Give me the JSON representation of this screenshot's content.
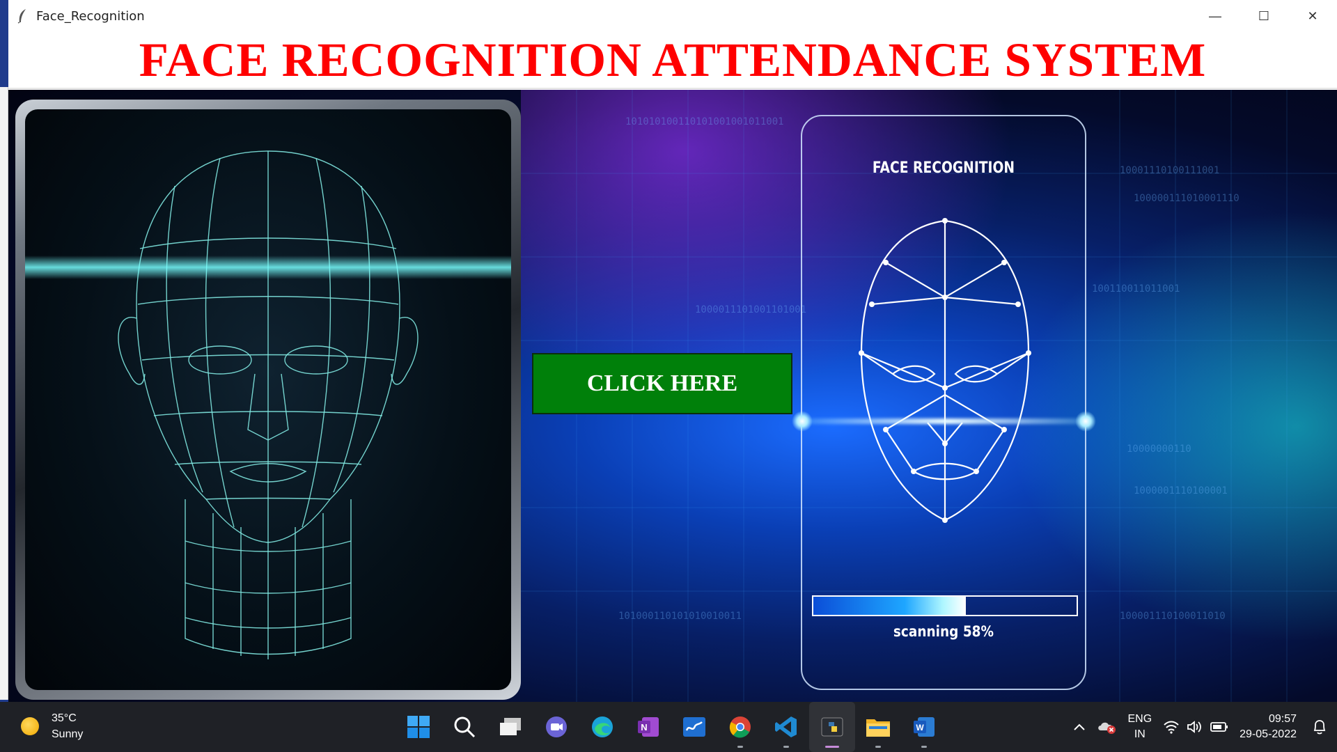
{
  "window": {
    "title": "Face_Recognition",
    "minimize_glyph": "—",
    "maximize_glyph": "☐",
    "close_glyph": "✕"
  },
  "header": {
    "heading": "FACE RECOGNITION ATTENDANCE SYSTEM",
    "heading_color": "#ff0000"
  },
  "main": {
    "button_label": "CLICK HERE",
    "button_color": "#00800a",
    "phone_title": "FACE RECOGNITION",
    "scan_progress": 0.58,
    "scan_text": "scanning 58%"
  },
  "taskbar": {
    "weather": {
      "temperature": "35°C",
      "condition": "Sunny",
      "icon": "sun-icon"
    },
    "apps": [
      {
        "name": "start-icon"
      },
      {
        "name": "search-icon"
      },
      {
        "name": "task-view-icon"
      },
      {
        "name": "teams-chat-icon"
      },
      {
        "name": "edge-icon"
      },
      {
        "name": "onenote-icon"
      },
      {
        "name": "whiteboard-icon"
      },
      {
        "name": "chrome-icon"
      },
      {
        "name": "vscode-icon"
      },
      {
        "name": "python-icon"
      },
      {
        "name": "file-explorer-icon"
      },
      {
        "name": "word-icon"
      }
    ],
    "tray": {
      "lang_top": "ENG",
      "lang_bottom": "IN",
      "time": "09:57",
      "date": "29-05-2022"
    }
  }
}
